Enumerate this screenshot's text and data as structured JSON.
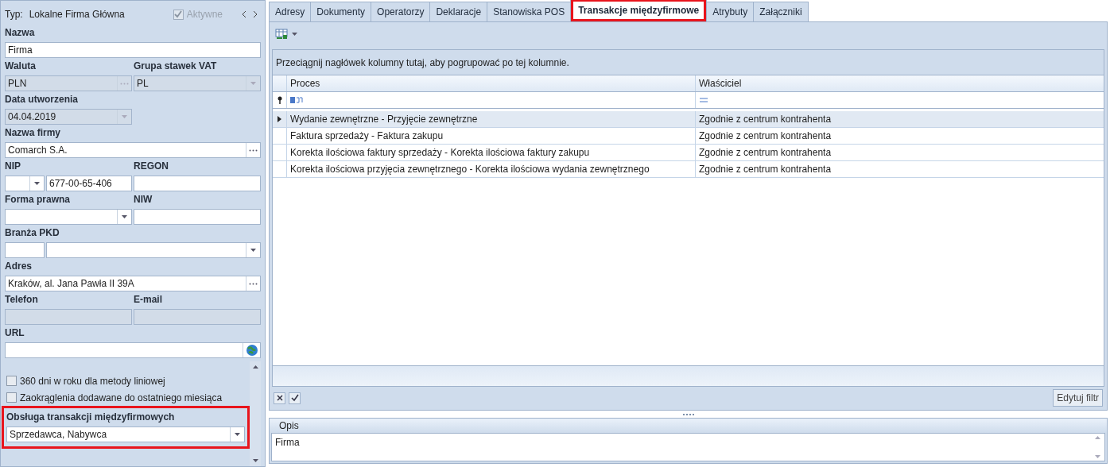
{
  "header": {
    "type_label": "Typ:",
    "type_value": "Lokalne Firma Główna",
    "active": {
      "label": "Aktywne",
      "checked": true,
      "disabled": true
    }
  },
  "form_rows": [
    {
      "fields": [
        {
          "label": "Nazwa",
          "parts": [
            {
              "kind": "text",
              "value": "Firma",
              "disabled": false
            }
          ]
        }
      ]
    },
    {
      "fields": [
        {
          "label": "Waluta",
          "parts": [
            {
              "kind": "picker",
              "value": "PLN",
              "disabled": true
            }
          ]
        },
        {
          "label": "Grupa stawek VAT",
          "parts": [
            {
              "kind": "combo",
              "value": "PL",
              "disabled": true
            }
          ]
        }
      ]
    },
    {
      "fields": [
        {
          "label": "Data utworzenia",
          "parts": [
            {
              "kind": "combo",
              "value": "04.04.2019",
              "disabled": true
            }
          ]
        }
      ]
    },
    {
      "fields": [
        {
          "label": "Nazwa firmy",
          "parts": [
            {
              "kind": "picker",
              "value": "Comarch S.A.",
              "disabled": false
            }
          ]
        }
      ]
    },
    {
      "fields": [
        {
          "label": "NIP",
          "parts": [
            {
              "kind": "combo",
              "disabled": false
            },
            {
              "kind": "text",
              "value": "677-00-65-406",
              "disabled": false
            }
          ]
        },
        {
          "label": "REGON",
          "parts": [
            {
              "kind": "text",
              "disabled": false
            }
          ]
        }
      ]
    },
    {
      "fields": [
        {
          "label": "Forma prawna",
          "parts": [
            {
              "kind": "combo",
              "disabled": false
            }
          ]
        },
        {
          "label": "NIW",
          "parts": [
            {
              "kind": "text",
              "disabled": false
            }
          ]
        }
      ]
    },
    {
      "fields": [
        {
          "label": "Branża PKD",
          "parts": [
            {
              "kind": "text",
              "disabled": false
            },
            {
              "kind": "combo",
              "disabled": false
            }
          ]
        }
      ]
    },
    {
      "fields": [
        {
          "label": "Adres",
          "parts": [
            {
              "kind": "picker",
              "value": "Kraków, al. Jana Pawła II 39A",
              "disabled": false
            }
          ]
        }
      ]
    },
    {
      "fields": [
        {
          "label": "Telefon",
          "parts": [
            {
              "kind": "text",
              "disabled": true
            }
          ]
        },
        {
          "label": "E-mail",
          "parts": [
            {
              "kind": "text",
              "disabled": true
            }
          ]
        }
      ]
    },
    {
      "fields": [
        {
          "label": "URL",
          "parts": [
            {
              "kind": "url",
              "disabled": false
            }
          ]
        }
      ]
    }
  ],
  "scroll_section": {
    "checkboxes": [
      {
        "label": "360 dni w roku dla metody liniowej",
        "checked": false
      },
      {
        "label": "Zaokrąglenia dodawane do ostatniego miesiąca",
        "checked": false
      }
    ],
    "intercompany": {
      "label": "Obsługa transakcji międzyfirmowych",
      "value": "Sprzedawca, Nabywca",
      "highlighted": true
    }
  },
  "tabs": [
    {
      "label": "Adresy",
      "selected": false,
      "highlighted": false
    },
    {
      "label": "Dokumenty",
      "selected": false,
      "highlighted": false
    },
    {
      "label": "Operatorzy",
      "selected": false,
      "highlighted": false
    },
    {
      "label": "Deklaracje",
      "selected": false,
      "highlighted": false
    },
    {
      "label": "Stanowiska POS",
      "selected": false,
      "highlighted": false
    },
    {
      "label": "Transakcje międzyfirmowe",
      "selected": true,
      "highlighted": true
    },
    {
      "label": "Atrybuty",
      "selected": false,
      "highlighted": false
    },
    {
      "label": "Załączniki",
      "selected": false,
      "highlighted": false
    }
  ],
  "grid": {
    "group_hint": "Przeciągnij nagłówek kolumny tutaj, aby pogrupować po tej kolumnie.",
    "columns": [
      "Proces",
      "Właściciel"
    ],
    "rows": [
      {
        "cells": [
          "Wydanie zewnętrzne - Przyjęcie zewnętrzne",
          "Zgodnie z centrum kontrahenta"
        ],
        "selected": true
      },
      {
        "cells": [
          "Faktura sprzedaży - Faktura zakupu",
          "Zgodnie z centrum kontrahenta"
        ],
        "selected": false
      },
      {
        "cells": [
          "Korekta ilościowa faktury sprzedaży - Korekta ilościowa faktury zakupu",
          "Zgodnie z centrum kontrahenta"
        ],
        "selected": false
      },
      {
        "cells": [
          "Korekta ilościowa przyjęcia zewnętrznego - Korekta ilościowa wydania zewnętrznego",
          "Zgodnie z centrum kontrahenta"
        ],
        "selected": false
      }
    ],
    "filter_enabled": true,
    "edit_filter": "Edytuj filtr"
  },
  "description": {
    "title": "Opis",
    "text": "Firma"
  }
}
